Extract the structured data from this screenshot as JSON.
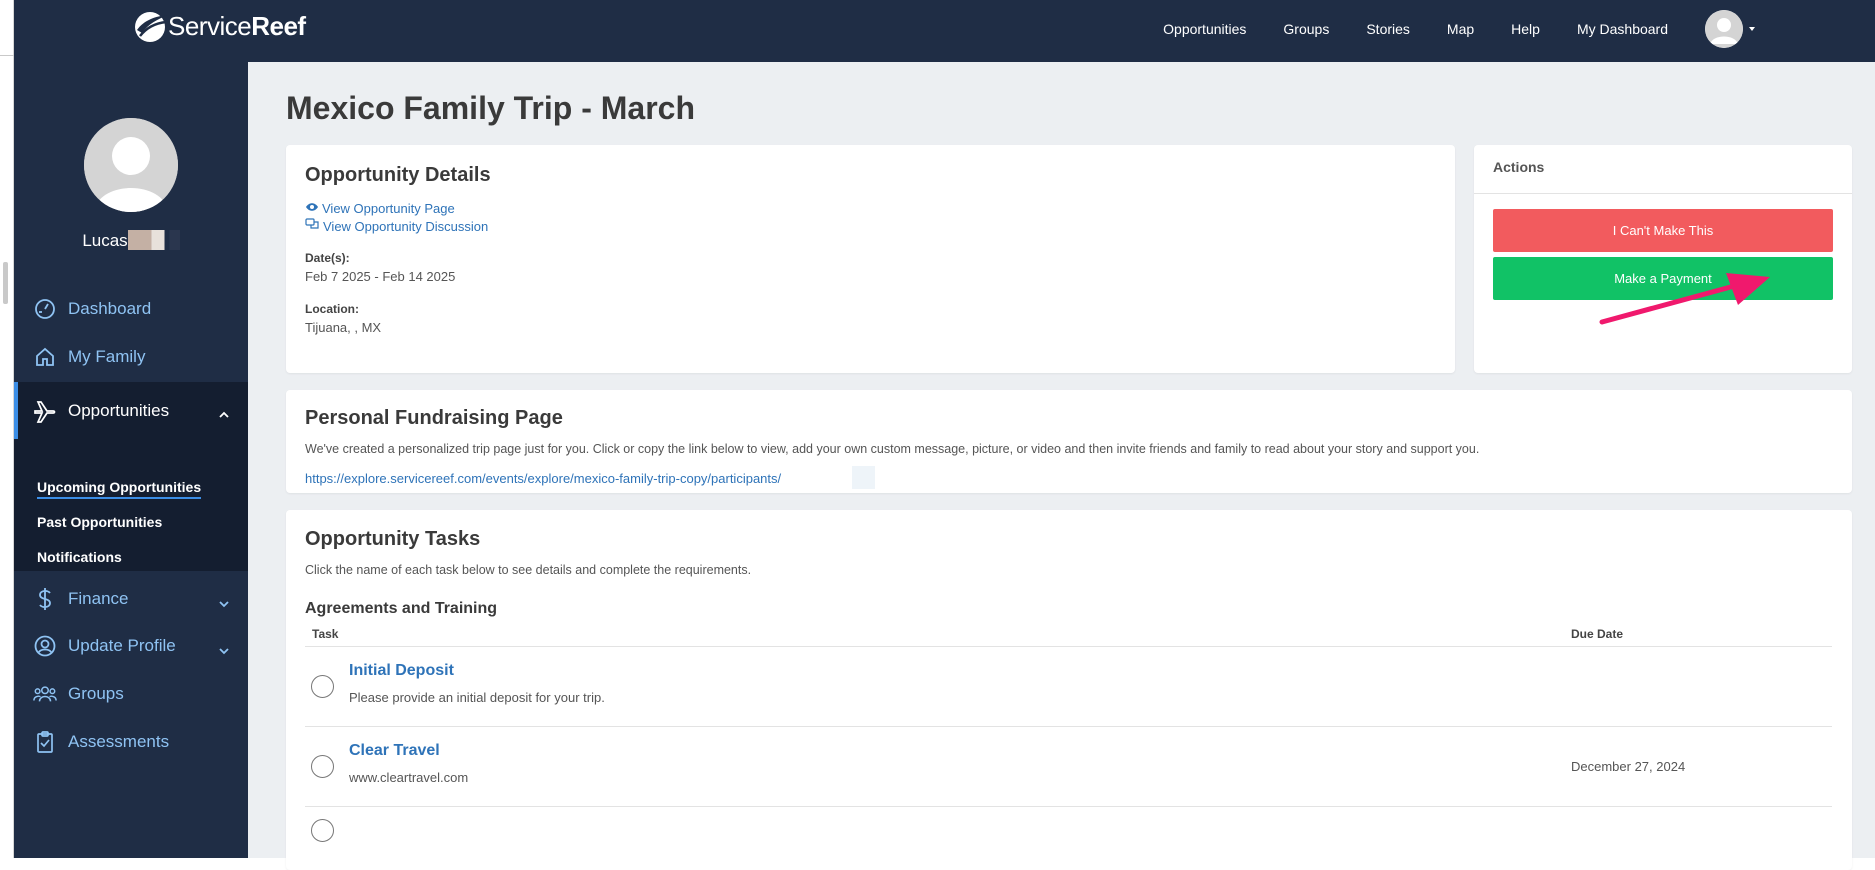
{
  "brand": {
    "name_light": "Service",
    "name_bold": "Reef"
  },
  "nav": {
    "items": [
      "Opportunities",
      "Groups",
      "Stories",
      "Map",
      "Help",
      "My Dashboard"
    ]
  },
  "sidebar": {
    "user_name": "Lucas",
    "items": [
      {
        "label": "Dashboard",
        "icon": "gauge-icon"
      },
      {
        "label": "My Family",
        "icon": "home-icon"
      },
      {
        "label": "Opportunities",
        "icon": "plane-icon"
      },
      {
        "label": "Finance",
        "icon": "dollar-icon"
      },
      {
        "label": "Update Profile",
        "icon": "user-circle-icon"
      },
      {
        "label": "Groups",
        "icon": "users-icon"
      },
      {
        "label": "Assessments",
        "icon": "clipboard-check-icon"
      }
    ],
    "sub_items": [
      "Upcoming Opportunities",
      "Past Opportunities",
      "Notifications"
    ]
  },
  "page": {
    "title": "Mexico Family Trip - March"
  },
  "details": {
    "heading": "Opportunity Details",
    "view_page": "View Opportunity Page",
    "view_discussion": "View Opportunity Discussion",
    "dates_label": "Date(s):",
    "dates_value": "Feb 7 2025 - Feb 14 2025",
    "location_label": "Location:",
    "location_value": "Tijuana, , MX"
  },
  "actions": {
    "heading": "Actions",
    "cant_make": "I Can't Make This",
    "payment": "Make a Payment",
    "colors": {
      "danger": "#f25b5e",
      "success": "#11c266"
    }
  },
  "fundraising": {
    "heading": "Personal Fundraising Page",
    "description": "We've created a personalized trip page just for you. Click or copy the link below to view, add your own custom message, picture, or video and then invite friends and family to read about your story and support you.",
    "url": "https://explore.servicereef.com/events/explore/mexico-family-trip-copy/participants/"
  },
  "tasks": {
    "heading": "Opportunity Tasks",
    "description": "Click the name of each task below to see details and complete the requirements.",
    "section": "Agreements and Training",
    "col_task": "Task",
    "col_due": "Due Date",
    "rows": [
      {
        "title": "Initial Deposit",
        "subtitle": "Please provide an initial deposit for your trip.",
        "due": ""
      },
      {
        "title": "Clear Travel",
        "subtitle": "www.cleartravel.com",
        "due": "December 27, 2024"
      }
    ]
  }
}
